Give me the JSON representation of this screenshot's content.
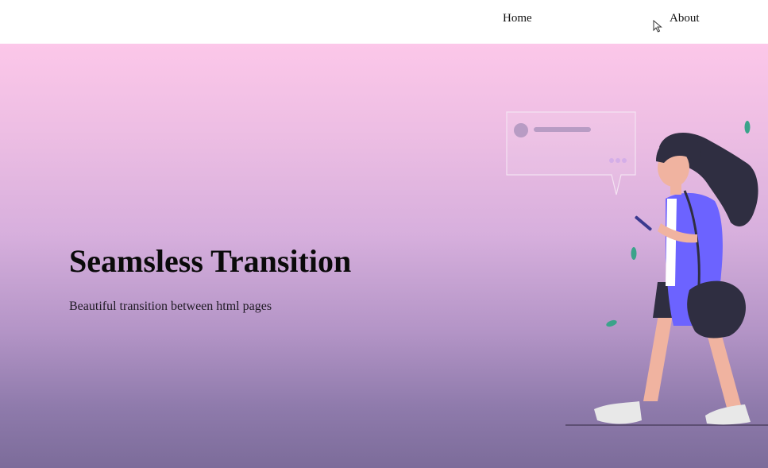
{
  "nav": {
    "home_label": "Home",
    "about_label": "About"
  },
  "hero": {
    "title": "Seamsless Transition",
    "subtitle": "Beautiful transition between html pages"
  },
  "colors": {
    "gradient_top": "#fcc7e9",
    "gradient_bottom": "#7c6c9a",
    "shirt": "#6c63ff",
    "hair": "#2f2e41",
    "leaf": "#3aa38a"
  },
  "icons": {
    "cursor": "mouse-pointer-icon",
    "illustration": "woman-walking-with-phone-illustration"
  }
}
